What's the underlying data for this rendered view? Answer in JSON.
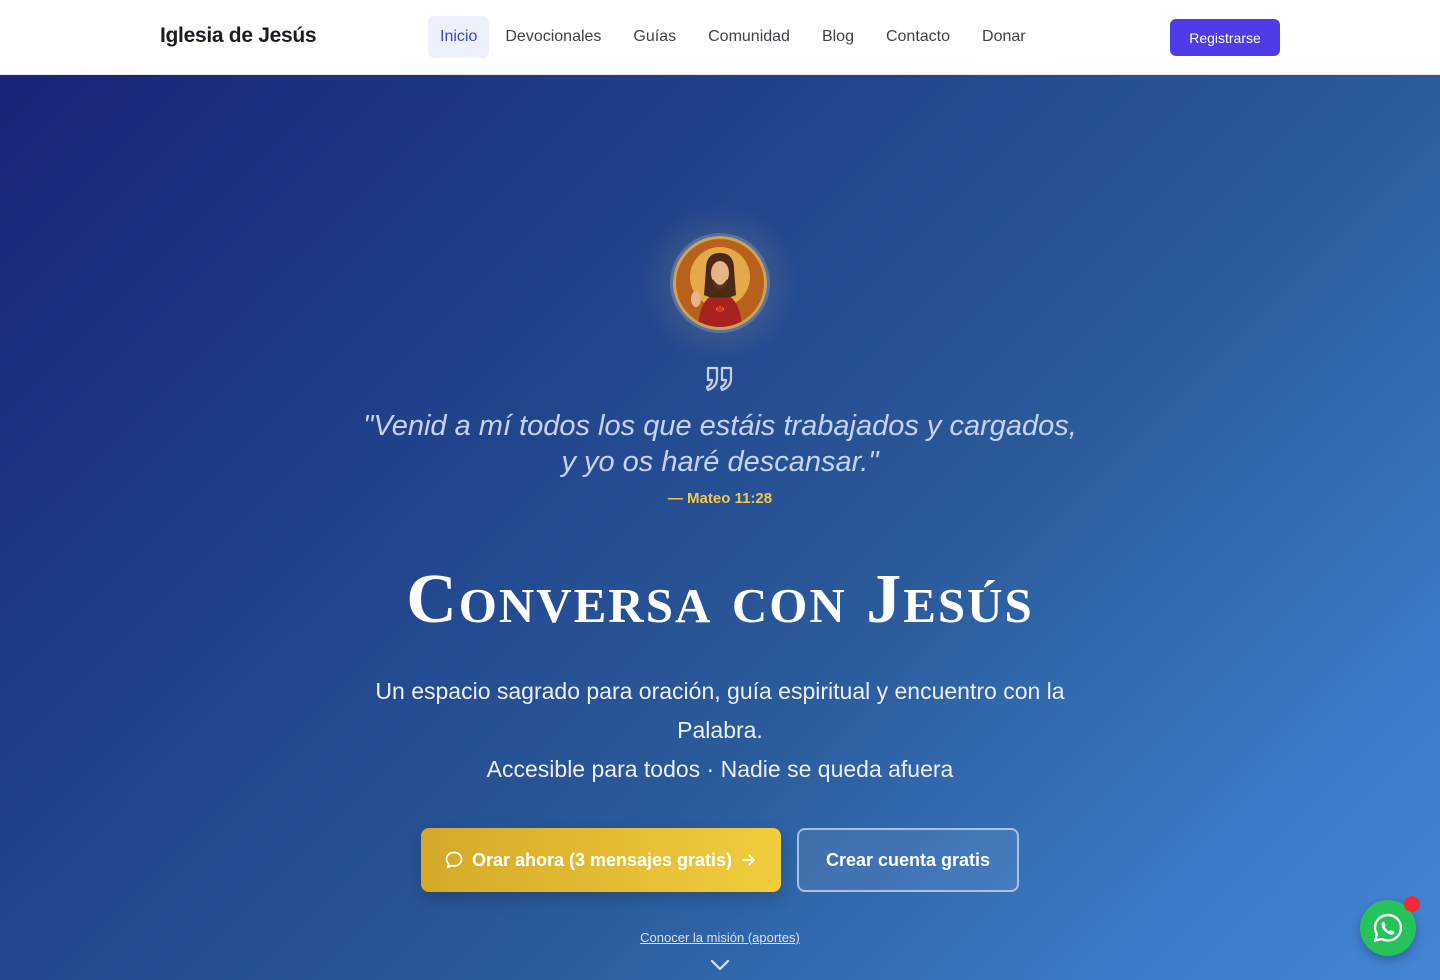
{
  "header": {
    "brand": "Iglesia de Jesús",
    "nav": [
      {
        "label": "Inicio",
        "active": true
      },
      {
        "label": "Devocionales"
      },
      {
        "label": "Guías"
      },
      {
        "label": "Comunidad"
      },
      {
        "label": "Blog"
      },
      {
        "label": "Contacto"
      },
      {
        "label": "Donar"
      }
    ],
    "register_label": "Registrarse"
  },
  "hero": {
    "verse_line1": "\"Venid a mí todos los que estáis trabajados y cargados,",
    "verse_line2": "y yo os haré descansar.\"",
    "verse_ref": "— Mateo 11:28",
    "title": "Conversa con Jesús",
    "subtitle_line1": "Un espacio sagrado para oración, guía espiritual y encuentro con la Palabra.",
    "subtitle_line2": "Accesible para todos · Nadie se queda afuera",
    "pray_button": "Orar ahora (3 mensajes gratis)",
    "create_button": "Crear cuenta gratis",
    "mission_link": "Conocer la misión (aportes)"
  },
  "icons": {
    "avatar": "jesus-portrait-icon",
    "quote": "quote-icon",
    "chat": "chat-bubble-icon",
    "arrow": "arrow-right-icon",
    "scroll": "chevron-down-icon",
    "whatsapp": "whatsapp-icon"
  },
  "colors": {
    "brand_accent": "#4f3be8",
    "gold": "#f1c84a",
    "whatsapp": "#25c35a",
    "notification": "#ee2a3a"
  }
}
